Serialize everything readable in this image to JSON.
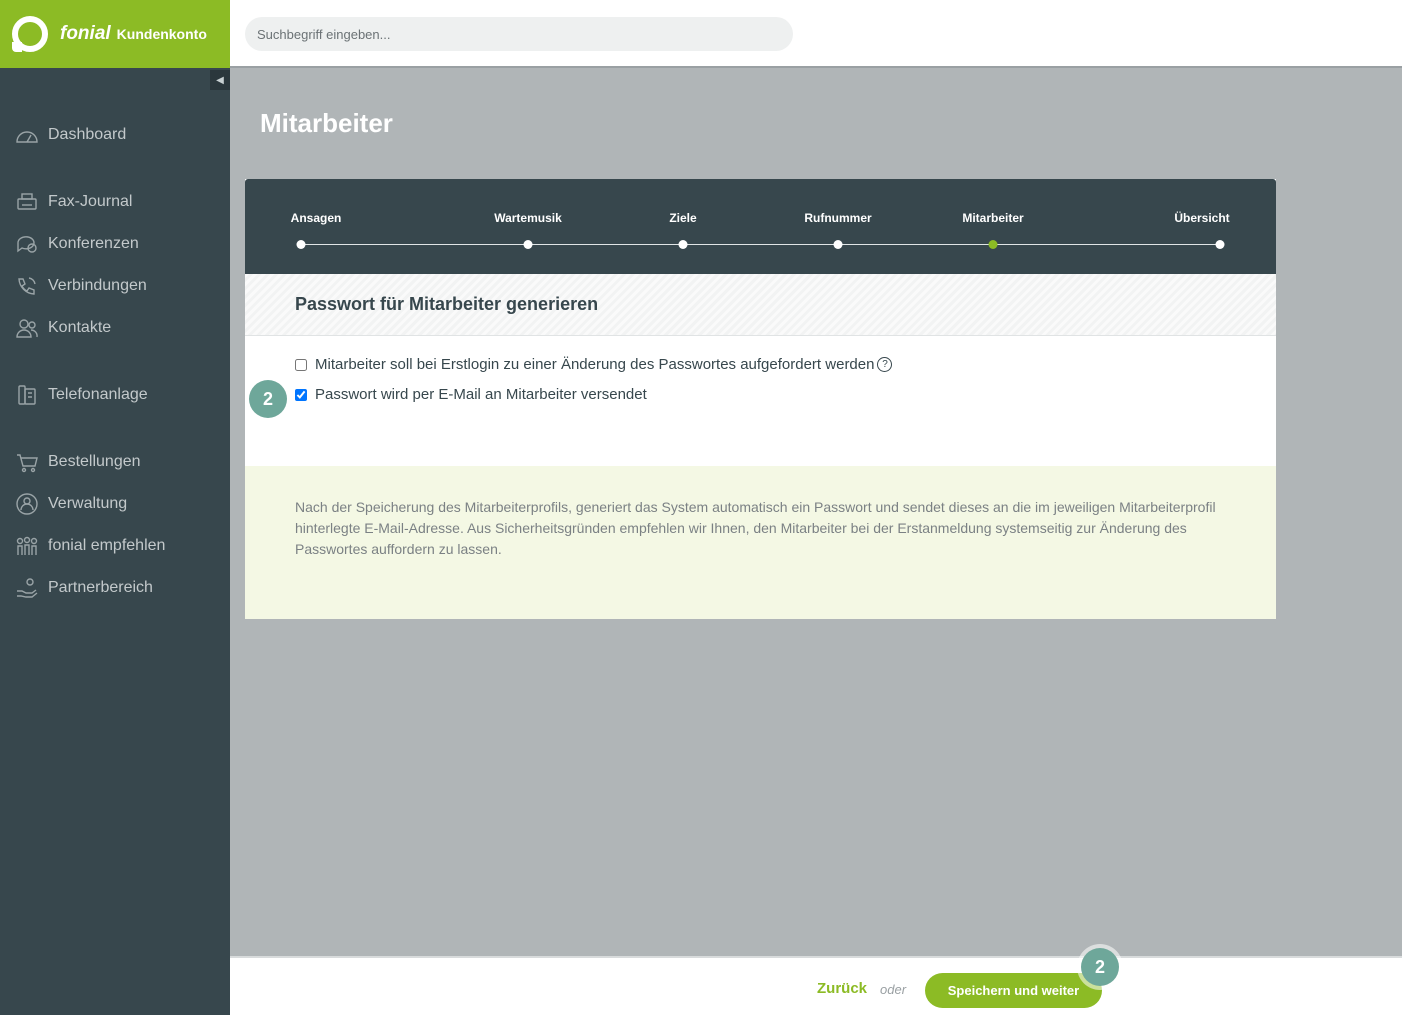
{
  "brand": {
    "name": "fonial",
    "sub": "Kundenkonto"
  },
  "search": {
    "placeholder": "Suchbegriff eingeben..."
  },
  "sidebar": {
    "items": [
      {
        "label": "Dashboard",
        "icon": "dashboard-icon"
      },
      {
        "label": "Fax-Journal",
        "icon": "fax-icon"
      },
      {
        "label": "Konferenzen",
        "icon": "conference-icon"
      },
      {
        "label": "Verbindungen",
        "icon": "phone-icon"
      },
      {
        "label": "Kontakte",
        "icon": "contacts-icon"
      },
      {
        "label": "Telefonanlage",
        "icon": "phone-system-icon"
      },
      {
        "label": "Bestellungen",
        "icon": "cart-icon"
      },
      {
        "label": "Verwaltung",
        "icon": "admin-icon"
      },
      {
        "label": "fonial empfehlen",
        "icon": "recommend-icon"
      },
      {
        "label": "Partnerbereich",
        "icon": "partner-icon"
      }
    ]
  },
  "page": {
    "title": "Mitarbeiter"
  },
  "stepper": {
    "steps": [
      "Ansagen",
      "Wartemusik",
      "Ziele",
      "Rufnummer",
      "Mitarbeiter",
      "Übersicht"
    ],
    "active": "Mitarbeiter"
  },
  "section": {
    "title": "Passwort für Mitarbeiter generieren"
  },
  "options": {
    "force_change_label": "Mitarbeiter soll bei Erstlogin zu einer Änderung des Passwortes aufgefordert werden",
    "force_change_checked": false,
    "help_symbol": "?",
    "email_label": "Passwort wird per E-Mail an Mitarbeiter versendet",
    "email_checked": true
  },
  "info": {
    "text": "Nach der Speicherung des Mitarbeiterprofils, generiert das System automatisch ein Passwort und sendet dieses an die im jeweiligen Mitarbeiterprofil hinterlegte E-Mail-Adresse. Aus Sicherheitsgründen empfehlen wir Ihnen, den Mitarbeiter bei der Erstanmeldung systemseitig zur Änderung des Passwortes auffordern zu lassen."
  },
  "badges": {
    "options_badge": "2",
    "save_badge": "2"
  },
  "footer": {
    "back_label": "Zurück",
    "or_label": "oder",
    "save_label": "Speichern und weiter"
  },
  "colors": {
    "brand_green": "#8cbb25",
    "sidebar_bg": "#37474d",
    "badge_teal": "#6ea79a"
  }
}
